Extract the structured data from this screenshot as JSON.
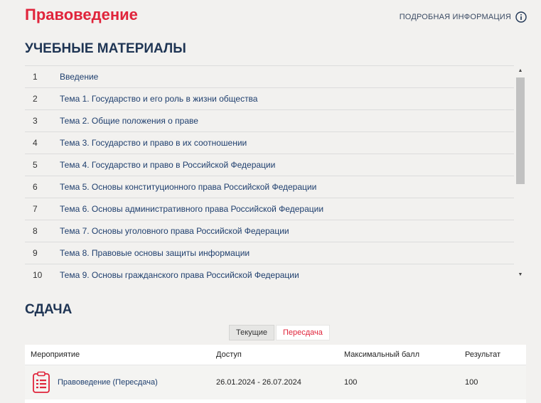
{
  "header": {
    "title": "Правоведение",
    "info_link": "ПОДРОБНАЯ ИНФОРМАЦИЯ"
  },
  "materials": {
    "title": "УЧЕБНЫЕ МАТЕРИАЛЫ",
    "items": [
      {
        "num": "1",
        "label": "Введение"
      },
      {
        "num": "2",
        "label": "Тема 1. Государство и его роль в жизни общества"
      },
      {
        "num": "3",
        "label": "Тема 2. Общие положения о праве"
      },
      {
        "num": "4",
        "label": "Тема 3. Государство и право в их соотношении"
      },
      {
        "num": "5",
        "label": "Тема 4. Государство и право в Российской Федерации"
      },
      {
        "num": "6",
        "label": "Тема 5. Основы конституционного права Российской Федерации"
      },
      {
        "num": "7",
        "label": "Тема 6. Основы административного права Российской Федерации"
      },
      {
        "num": "8",
        "label": "Тема 7. Основы уголовного права Российской Федерации"
      },
      {
        "num": "9",
        "label": "Тема 8. Правовые основы защиты информации"
      },
      {
        "num": "10",
        "label": "Тема 9. Основы гражданского права Российской Федерации"
      }
    ]
  },
  "submission": {
    "title": "СДАЧА",
    "tabs": [
      {
        "label": "Текущие"
      },
      {
        "label": "Пересдача"
      }
    ],
    "table": {
      "headers": [
        "Мероприятие",
        "Доступ",
        "Максимальный балл",
        "Результат"
      ],
      "rows": [
        {
          "event": "Правоведение (Пересдача)",
          "access": "26.01.2024 - 26.07.2024",
          "max_score": "100",
          "result": "100"
        }
      ]
    }
  },
  "colors": {
    "accent": "#e0243b",
    "heading": "#1f3554",
    "link": "#1f3f6e",
    "background": "#f2f1ef"
  },
  "icons": {
    "info": "info-circle-icon",
    "event": "clipboard-list-icon",
    "scroll_up": "arrow-up-icon",
    "scroll_down": "arrow-down-icon"
  }
}
